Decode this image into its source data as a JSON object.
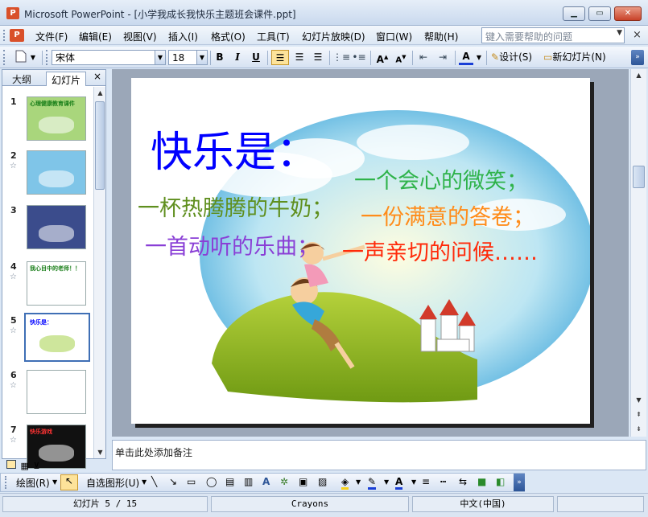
{
  "window": {
    "title": "Microsoft PowerPoint - [小学我成长我快乐主题班会课件.ppt]",
    "min_label": "▁",
    "max_label": "▭",
    "close_label": "✕"
  },
  "menubar": {
    "items": [
      "文件(F)",
      "编辑(E)",
      "视图(V)",
      "插入(I)",
      "格式(O)",
      "工具(T)",
      "幻灯片放映(D)",
      "窗口(W)",
      "帮助(H)"
    ],
    "help_placeholder": "键入需要帮助的问题",
    "doc_close": "×"
  },
  "toolbar": {
    "font_name": "宋体",
    "font_size": "18",
    "bold": "B",
    "italic": "I",
    "underline": "U",
    "design_label": "设计(S)",
    "new_slide_label": "新幻灯片(N)"
  },
  "left_panel": {
    "tab_outline": "大纲",
    "tab_slides": "幻灯片",
    "close": "×",
    "thumbnails": [
      {
        "num": "1",
        "star": "",
        "selected": false,
        "bg": "#a9d67c",
        "title": "心理健康教育课件",
        "title_color": "#1a7f1a"
      },
      {
        "num": "2",
        "star": "☆",
        "selected": false,
        "bg": "#7fc5e8",
        "title": "",
        "title_color": "#c00"
      },
      {
        "num": "3",
        "star": "",
        "selected": false,
        "bg": "#3b4c8c",
        "title": "",
        "title_color": "#fff"
      },
      {
        "num": "4",
        "star": "☆",
        "selected": false,
        "bg": "#ffffff",
        "title": "我心目中的老师！！",
        "title_color": "#1a7f1a"
      },
      {
        "num": "5",
        "star": "☆",
        "selected": true,
        "bg": "#ffffff",
        "title": "快乐是：",
        "title_color": "#0000ff"
      },
      {
        "num": "6",
        "star": "☆",
        "selected": false,
        "bg": "#ffffff",
        "title": "",
        "title_color": "#c00"
      },
      {
        "num": "7",
        "star": "☆",
        "selected": false,
        "bg": "#111111",
        "title": "快乐游戏",
        "title_color": "#ff3333"
      }
    ]
  },
  "slide": {
    "heading": "快乐是：",
    "line1": "一个会心的微笑；",
    "line2": "一杯热腾腾的牛奶；",
    "line3": "一份满意的答卷；",
    "line4": "一首动听的乐曲；",
    "line5": "一声亲切的问候……",
    "colors": {
      "heading": "#0000ff",
      "line1": "#2fb34b",
      "line2": "#5f8f1e",
      "line3": "#ff8c1a",
      "line4": "#8a3fd6",
      "line5": "#ff2a0a"
    }
  },
  "notes": {
    "placeholder": "单击此处添加备注"
  },
  "drawbar": {
    "draw_label": "绘图(R)",
    "autoshapes_label": "自选图形(U)"
  },
  "status": {
    "slide_pos": "幻灯片 5 / 15",
    "theme": "Crayons",
    "language": "中文(中国)"
  }
}
